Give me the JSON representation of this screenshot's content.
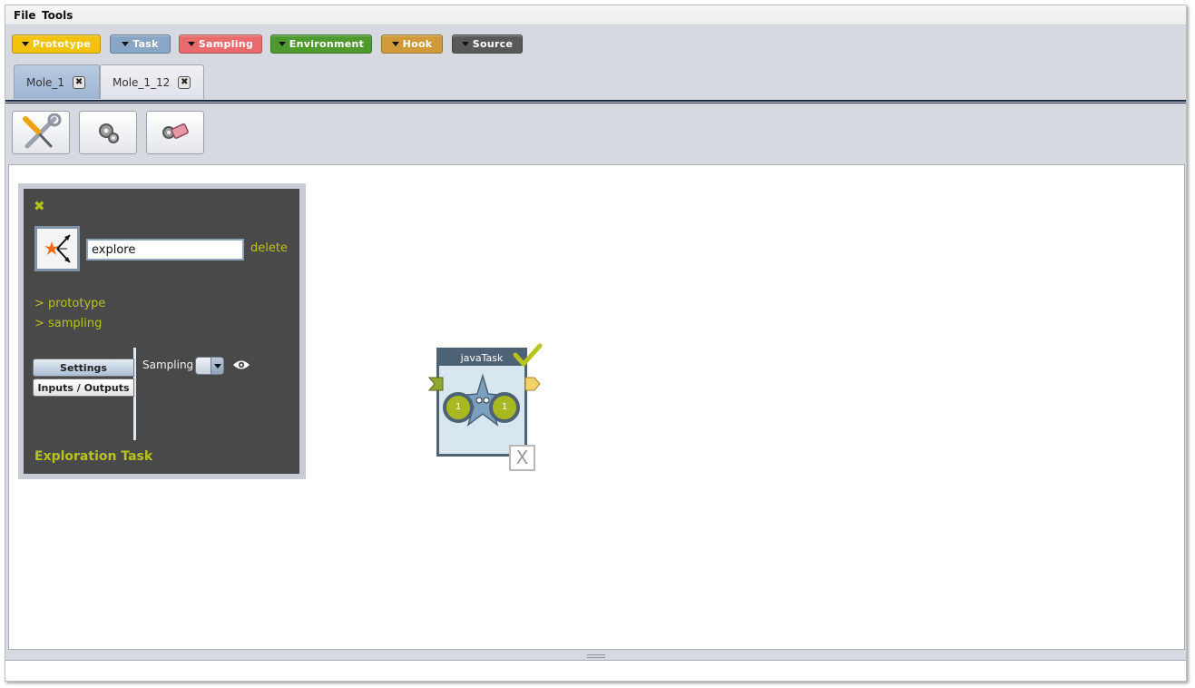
{
  "menu": {
    "file": "File",
    "tools": "Tools"
  },
  "palette": [
    {
      "label": "Prototype",
      "color": "#f2c20c"
    },
    {
      "label": "Task",
      "color": "#8aa6c7"
    },
    {
      "label": "Sampling",
      "color": "#e96c6c"
    },
    {
      "label": "Environment",
      "color": "#4f9a2e"
    },
    {
      "label": "Hook",
      "color": "#d09a3a"
    },
    {
      "label": "Source",
      "color": "#595959"
    }
  ],
  "tabs": [
    {
      "label": "Mole_1",
      "active": true
    },
    {
      "label": "Mole_1_12",
      "active": false
    }
  ],
  "toolbar": [
    {
      "icon": "tools-icon"
    },
    {
      "icon": "gears-icon"
    },
    {
      "icon": "eraser-icon"
    }
  ],
  "task_panel": {
    "close_icon": "close-icon",
    "name_value": "explore",
    "delete_label": "delete",
    "prototype_link": "> prototype",
    "sampling_link": "> sampling",
    "tab_settings": "Settings",
    "tab_io": "Inputs / Outputs",
    "sampling_label": "Sampling",
    "title": "Exploration Task"
  },
  "node": {
    "title": "javaTask",
    "input_slot": "1",
    "output_slot": "1",
    "close_label": "X"
  },
  "colors": {
    "accent": "#b9c31e",
    "panel_bg": "#494949",
    "node_header": "#4e6275"
  }
}
